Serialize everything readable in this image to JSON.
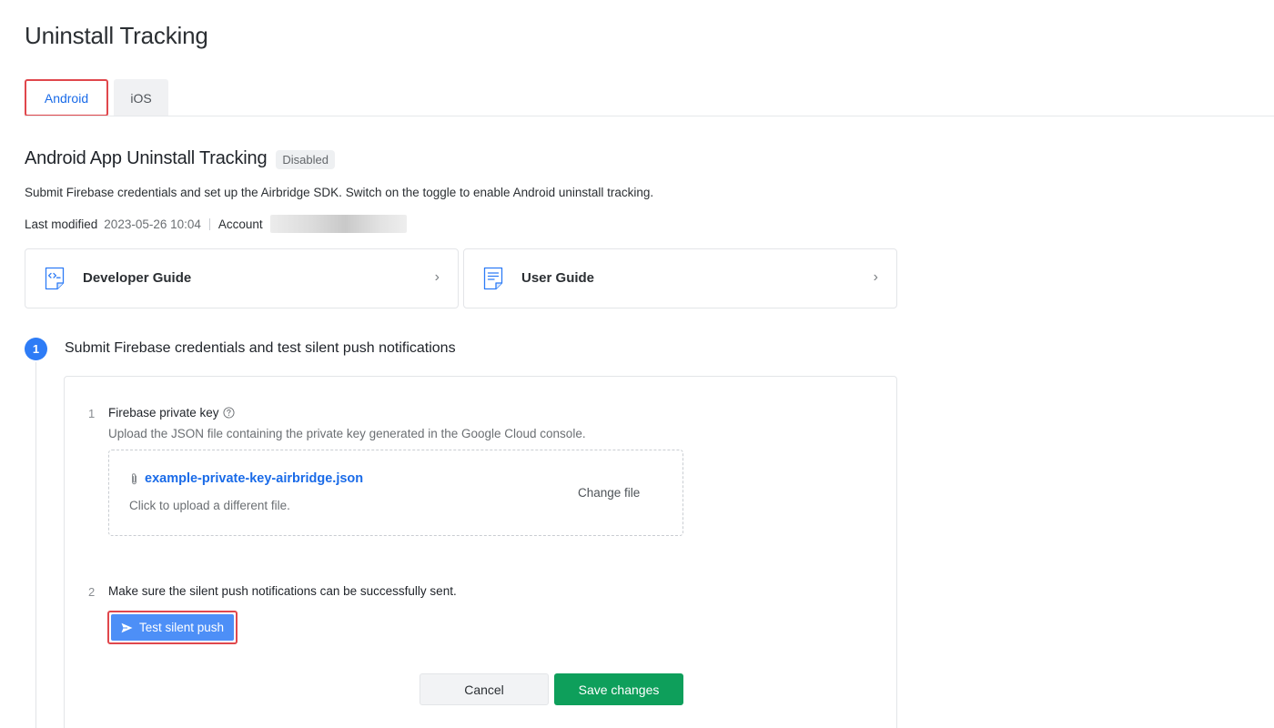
{
  "page": {
    "title": "Uninstall Tracking"
  },
  "tabs": [
    {
      "label": "Android",
      "active": true
    },
    {
      "label": "iOS",
      "active": false
    }
  ],
  "section": {
    "title": "Android App Uninstall Tracking",
    "status_badge": "Disabled",
    "description": "Submit Firebase credentials and set up the Airbridge SDK. Switch on the toggle to enable Android uninstall tracking.",
    "last_modified_label": "Last modified",
    "last_modified_value": "2023-05-26 10:04",
    "account_label": "Account"
  },
  "guides": [
    {
      "label": "Developer Guide",
      "icon": "code-document-icon"
    },
    {
      "label": "User Guide",
      "icon": "document-icon"
    }
  ],
  "step1": {
    "number": "1",
    "title": "Submit Firebase credentials and test silent push notifications",
    "item1": {
      "number": "1",
      "label": "Firebase private key",
      "description": "Upload the JSON file containing the private key generated in the Google Cloud console.",
      "file_name": "example-private-key-airbridge.json",
      "upload_hint": "Click to upload a different file.",
      "change_file_label": "Change file"
    },
    "item2": {
      "number": "2",
      "text": "Make sure the silent push notifications can be successfully sent.",
      "button_label": "Test silent push"
    }
  },
  "actions": {
    "cancel_label": "Cancel",
    "save_label": "Save changes"
  },
  "colors": {
    "accent_blue": "#1a6be8",
    "step_blue": "#2e7cf6",
    "button_blue": "#4d8ff7",
    "save_green": "#0e9f5b",
    "highlight_red": "#e0474c"
  }
}
